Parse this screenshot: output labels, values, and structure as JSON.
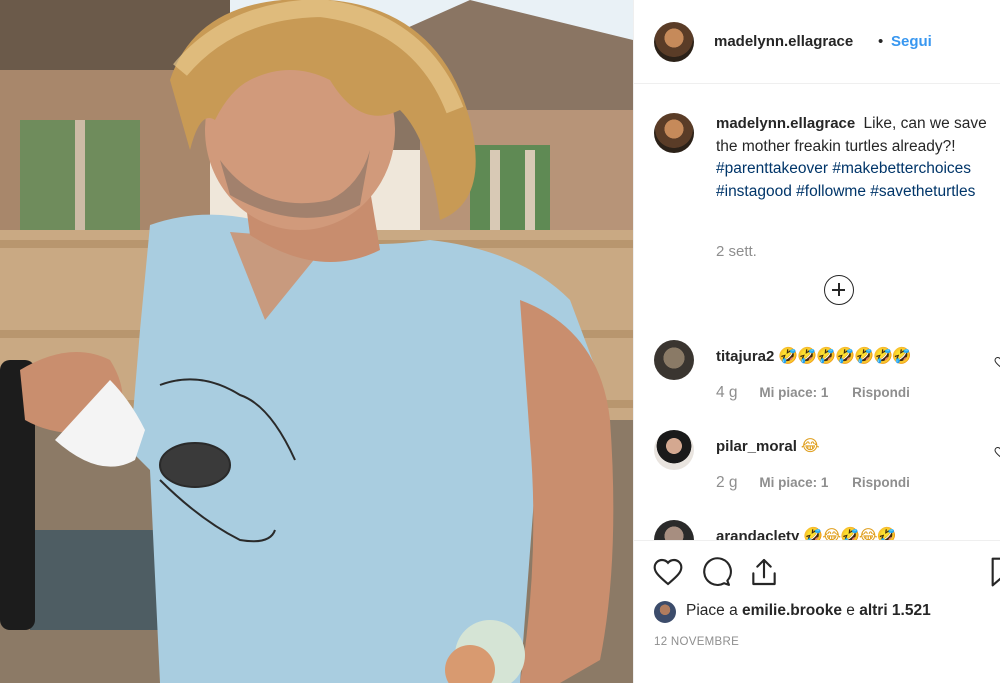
{
  "header": {
    "username": "madelynn.ellagrace",
    "separator": "•",
    "follow_label": "Segui"
  },
  "caption": {
    "username": "madelynn.ellagrace",
    "text": "Like, can we save the mother freakin turtles already?!",
    "hashtags": [
      "#parenttakeover",
      "#makebetterchoices",
      "#instagood",
      "#followme",
      "#savetheturtles"
    ],
    "time": "2 sett.",
    "load_more_icon": "plus-circle-icon"
  },
  "comments": [
    {
      "username": "titajura2",
      "emoji": "🤣🤣🤣🤣🤣🤣🤣",
      "age": "4 g",
      "likes": "Mi piace: 1",
      "reply": "Rispondi"
    },
    {
      "username": "pilar_moral",
      "emoji": "😂",
      "age": "2 g",
      "likes": "Mi piace: 1",
      "reply": "Rispondi"
    },
    {
      "username": "arandaclety",
      "emoji": "🤣😂🤣😂🤣"
    }
  ],
  "actions": {
    "icons": [
      "heart-icon",
      "comment-icon",
      "share-icon",
      "bookmark-icon"
    ],
    "likes_prefix": "Piace a",
    "likes_user": "emilie.brooke",
    "likes_join": "e",
    "likes_rest": "altri 1.521",
    "date": "12 NOVEMBRE"
  },
  "colors": {
    "link": "#3897f0",
    "hashtag": "#003569",
    "muted": "#8e8e8e",
    "shirt": "#a9cde0"
  }
}
